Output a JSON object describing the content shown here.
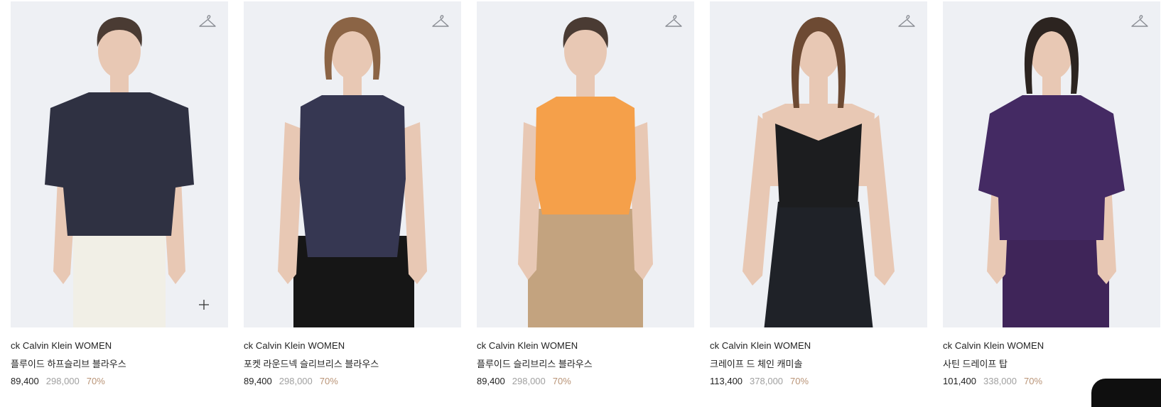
{
  "products": [
    {
      "brand": "ck Calvin Klein WOMEN",
      "name": "플루이드 하프슬리브 블라우스",
      "price": "89,400",
      "original": "298,000",
      "discount": "70%",
      "top_color": "#2f3142",
      "bottom_color": "#f1efe6",
      "hair_color": "#4a3b33",
      "top_style": "shirt-short-sleeve"
    },
    {
      "brand": "ck Calvin Klein WOMEN",
      "name": "포켓 라운드넥 슬리브리스 블라우스",
      "price": "89,400",
      "original": "298,000",
      "discount": "70%",
      "top_color": "#363752",
      "bottom_color": "#161616",
      "hair_color": "#8b6445",
      "top_style": "sleeveless"
    },
    {
      "brand": "ck Calvin Klein WOMEN",
      "name": "플루이드 슬리브리스 블라우스",
      "price": "89,400",
      "original": "298,000",
      "discount": "70%",
      "top_color": "#f5a04a",
      "bottom_color": "#c3a37f",
      "hair_color": "#4a3b33",
      "top_style": "sleeveless"
    },
    {
      "brand": "ck Calvin Klein WOMEN",
      "name": "크레이프 드 체인 캐미솔",
      "price": "113,400",
      "original": "378,000",
      "discount": "70%",
      "top_color": "#1c1d1f",
      "bottom_color": "#1f2228",
      "hair_color": "#6d4a33",
      "top_style": "camisole"
    },
    {
      "brand": "ck Calvin Klein WOMEN",
      "name": "사틴 드레이프 탑",
      "price": "101,400",
      "original": "338,000",
      "discount": "70%",
      "top_color": "#442a63",
      "bottom_color": "#3f2559",
      "hair_color": "#2c2420",
      "top_style": "puff-sleeve"
    }
  ],
  "icons": {
    "wishlist": "hanger-icon",
    "add": "plus-icon"
  },
  "colors": {
    "photo_bg": "#eef0f4",
    "skin": "#e8c8b4",
    "discount": "#b99477",
    "original_price": "#a0a0a0"
  }
}
